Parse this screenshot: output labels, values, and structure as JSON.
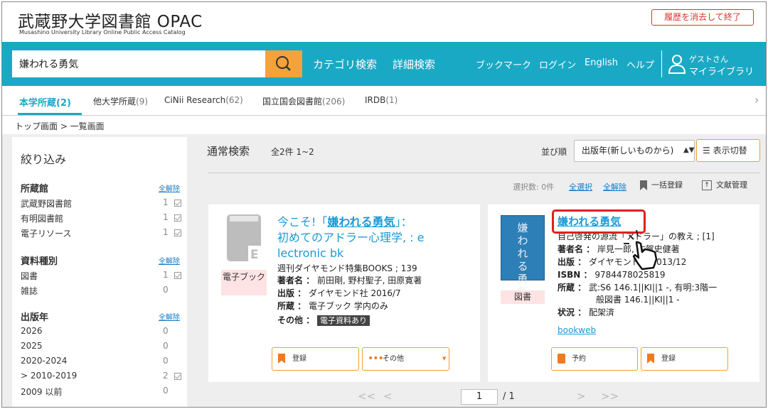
{
  "header": {
    "title": "武蔵野大学図書館 OPAC",
    "subtitle": "Musashino University Library Online Public Access Catalog",
    "clear_history": "履歴を消去して終了"
  },
  "search": {
    "query": "嫌われる勇気",
    "nav_category": "カテゴリ検索",
    "nav_advanced": "詳細検索",
    "nav_bookmark": "ブックマーク",
    "nav_login": "ログイン",
    "nav_english": "English",
    "nav_help": "ヘルプ",
    "guest": "ゲストさん",
    "mylibrary": "マイライブラリ"
  },
  "tabs": [
    {
      "label": "本学所蔵",
      "count": "(2)"
    },
    {
      "label": "他大学所蔵",
      "count": "(9)"
    },
    {
      "label": "CiNii Research",
      "count": "(62)"
    },
    {
      "label": "国立国会図書館",
      "count": "(206)"
    },
    {
      "label": "IRDB",
      "count": "(1)"
    }
  ],
  "breadcrumb": "トップ画面 > 一覧画面",
  "sidebar": {
    "title": "絞り込み",
    "clear_label": "全解除",
    "sections": [
      {
        "title": "所蔵館",
        "items": [
          {
            "label": "武蔵野図書館",
            "count": "1"
          },
          {
            "label": "有明図書館",
            "count": "1"
          },
          {
            "label": "電子リソース",
            "count": "1"
          }
        ]
      },
      {
        "title": "資料種別",
        "items": [
          {
            "label": "図書",
            "count": "1"
          },
          {
            "label": "雑誌",
            "count": "0"
          }
        ]
      },
      {
        "title": "出版年",
        "items": [
          {
            "label": "2026",
            "count": "0"
          },
          {
            "label": "2025",
            "count": "0"
          },
          {
            "label": "2020-2024",
            "count": "0"
          },
          {
            "label": "> 2010-2019",
            "count": "2"
          },
          {
            "label": "2009 以前",
            "count": "0"
          }
        ]
      }
    ]
  },
  "results": {
    "label": "通常検索",
    "count_text": "全2件 1~2",
    "sort_label": "並び順",
    "sort_value": "出版年(新しいものから)",
    "view_toggle": "表示切替",
    "selected_count": "選択数: 0件",
    "select_all": "全選択",
    "clear_all": "全解除",
    "bulk_register": "一括登録",
    "doc_manage": "文献管理"
  },
  "items": [
    {
      "title_prefix": "今こそ!「",
      "title_keyword": "嫌われる勇気",
      "title_line1_rest": "」：",
      "title_line2": "初めてのアドラー心理学, : e",
      "title_line3": "lectronic bk",
      "series": "週刊ダイヤモンド特集BOOKS ; 139",
      "author_label": "著者名 ：",
      "author": "前田剛, 野村聖子, 田原寛著",
      "publisher_label": "出版 ：",
      "publisher": "ダイヤモンド社 2016/7",
      "holding_label": "所蔵 ：",
      "holding": "電子ブック 学内のみ",
      "other_label": "その他 ：",
      "other_badge": "電子資料あり",
      "type": "電子ブック",
      "btn_register": "登録",
      "btn_other": "その他"
    },
    {
      "title": "嫌われる勇気",
      "subtitle": "自己啓発の源流「アドラー」の教え ; [1]",
      "author_label": "著者名 ：",
      "author": "岸見一郎, 古賀史健著",
      "publisher_label": "出版 ：",
      "publisher": "ダイヤモンド社 2013/12",
      "isbn_label": "ISBN ：",
      "isbn": "9784478025819",
      "holding_label": "所蔵 ：",
      "holding_line1": "武:S6 146.1||KI||1 -, 有明:3階一",
      "holding_line2": "般図書 146.1||KI||1 -",
      "status_label": "状況 ：",
      "status": "配架済",
      "link": "bookweb",
      "type": "図書",
      "cover_text": "嫌われる勇気",
      "btn_reserve": "予約",
      "btn_register": "登録"
    }
  ],
  "pager": {
    "first": "<<",
    "prev": "<",
    "page": "1",
    "total": "/ 1",
    "next": ">",
    "last": ">>"
  },
  "colors": {
    "teal": "#1aa9c4",
    "orange": "#f5a23a",
    "link": "#1a9ad6",
    "highlight": "#e02020"
  }
}
